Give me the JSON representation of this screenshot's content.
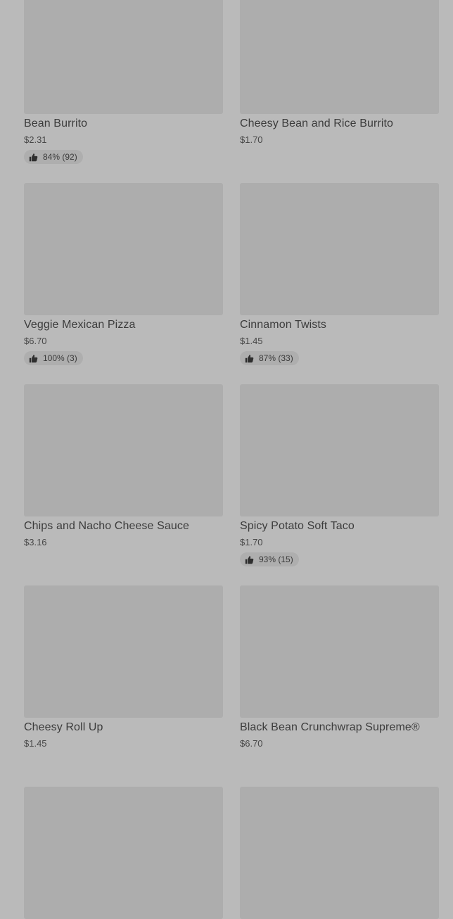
{
  "items": [
    {
      "name": "Bean Burrito",
      "price": "$2.31",
      "rating": "84% (92)"
    },
    {
      "name": "Cheesy Bean and Rice Burrito",
      "price": "$1.70",
      "rating": null
    },
    {
      "name": "Veggie Mexican Pizza",
      "price": "$6.70",
      "rating": "100% (3)"
    },
    {
      "name": "Cinnamon Twists",
      "price": "$1.45",
      "rating": "87% (33)"
    },
    {
      "name": "Chips and Nacho Cheese Sauce",
      "price": "$3.16",
      "rating": null
    },
    {
      "name": "Spicy Potato Soft Taco",
      "price": "$1.70",
      "rating": "93% (15)"
    },
    {
      "name": "Cheesy Roll Up",
      "price": "$1.45",
      "rating": null
    },
    {
      "name": "Black Bean Crunchwrap Supreme®",
      "price": "$6.70",
      "rating": null
    }
  ],
  "icons": {
    "rating": "thumbs-up-icon"
  },
  "colors": {
    "background": "#bababa",
    "image_placeholder": "#adadad",
    "rating_pill": "#aeaeae"
  }
}
